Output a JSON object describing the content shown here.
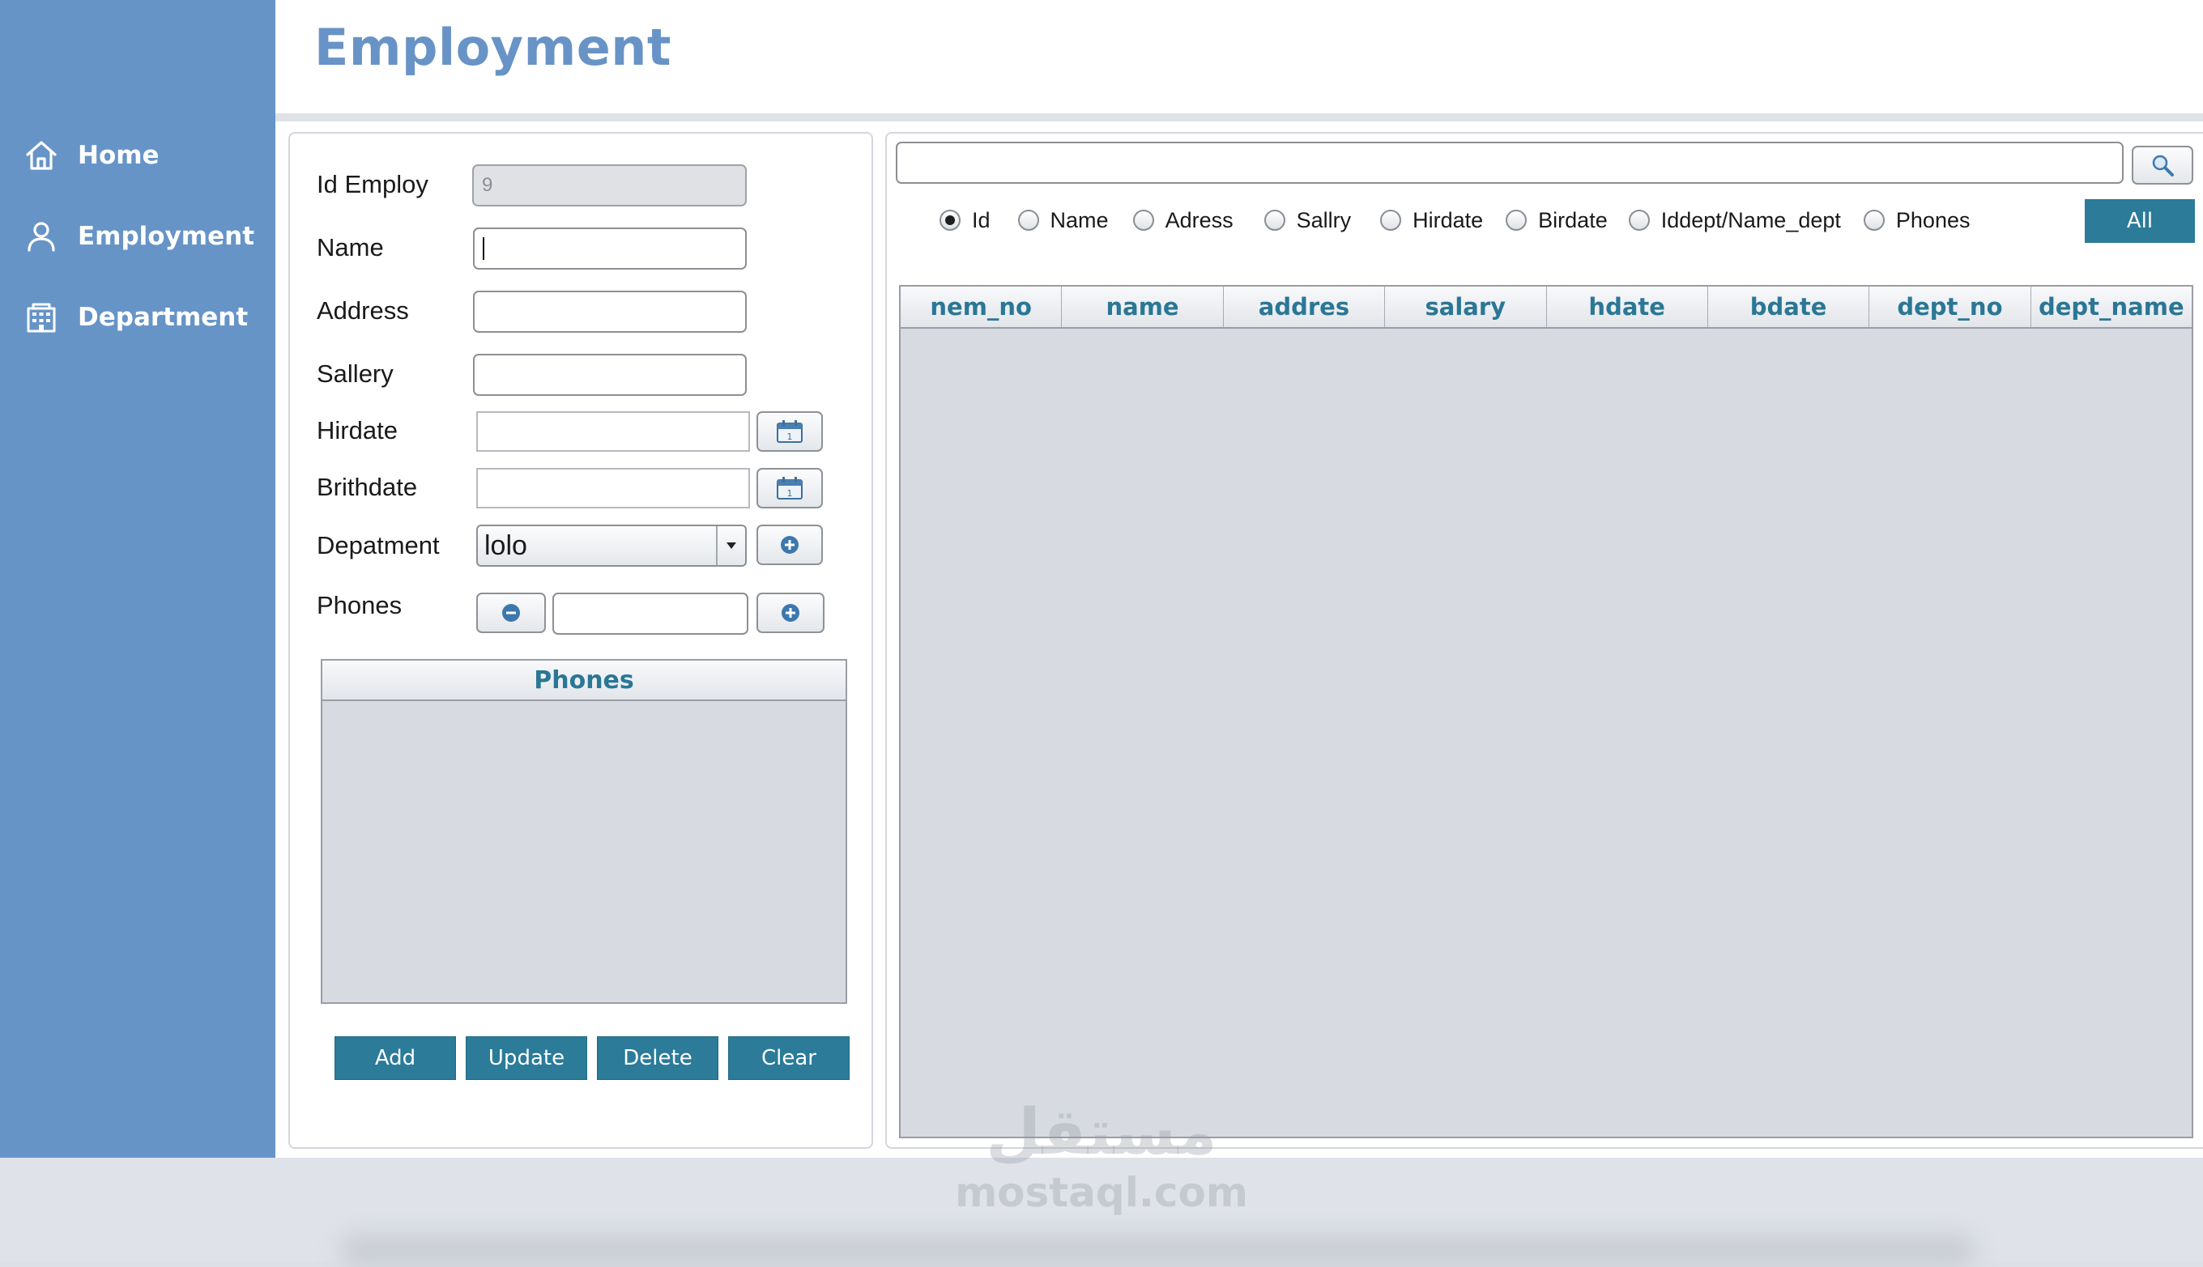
{
  "app": {
    "title": "Employment",
    "accent_color": "#2b7b99",
    "sidebar_color": "#6694c7",
    "title_color": "#6893c6"
  },
  "sidebar": {
    "items": [
      {
        "label": "Home",
        "icon": "home-icon"
      },
      {
        "label": "Employment",
        "icon": "user-icon"
      },
      {
        "label": "Department",
        "icon": "building-icon"
      }
    ]
  },
  "form": {
    "id_label": "Id Employ",
    "id_value": "9",
    "name_label": "Name",
    "name_value": "",
    "address_label": "Address",
    "address_value": "",
    "salary_label": "Sallery",
    "salary_value": "",
    "hiredate_label": "Hirdate",
    "hiredate_value": "",
    "birthdate_label": "Brithdate",
    "birthdate_value": "",
    "department_label": "Depatment",
    "department_selected": "lolo",
    "phones_label": "Phones",
    "phone_value": "",
    "phones_table_header": "Phones",
    "buttons": {
      "add": "Add",
      "update": "Update",
      "delete": "Delete",
      "clear": "Clear"
    }
  },
  "search": {
    "value": "",
    "all_button": "All",
    "filters": [
      {
        "label": "Id",
        "checked": true
      },
      {
        "label": "Name",
        "checked": false
      },
      {
        "label": "Adress",
        "checked": false
      },
      {
        "label": "Sallry",
        "checked": false
      },
      {
        "label": "Hirdate",
        "checked": false
      },
      {
        "label": "Birdate",
        "checked": false
      },
      {
        "label": "Iddept/Name_dept",
        "checked": false
      },
      {
        "label": "Phones",
        "checked": false
      }
    ]
  },
  "table": {
    "columns": [
      "nem_no",
      "name",
      "addres",
      "salary",
      "hdate",
      "bdate",
      "dept_no",
      "dept_name"
    ],
    "rows": []
  },
  "watermark": {
    "arabic": "مستقل",
    "latin": "mostaql.com"
  }
}
